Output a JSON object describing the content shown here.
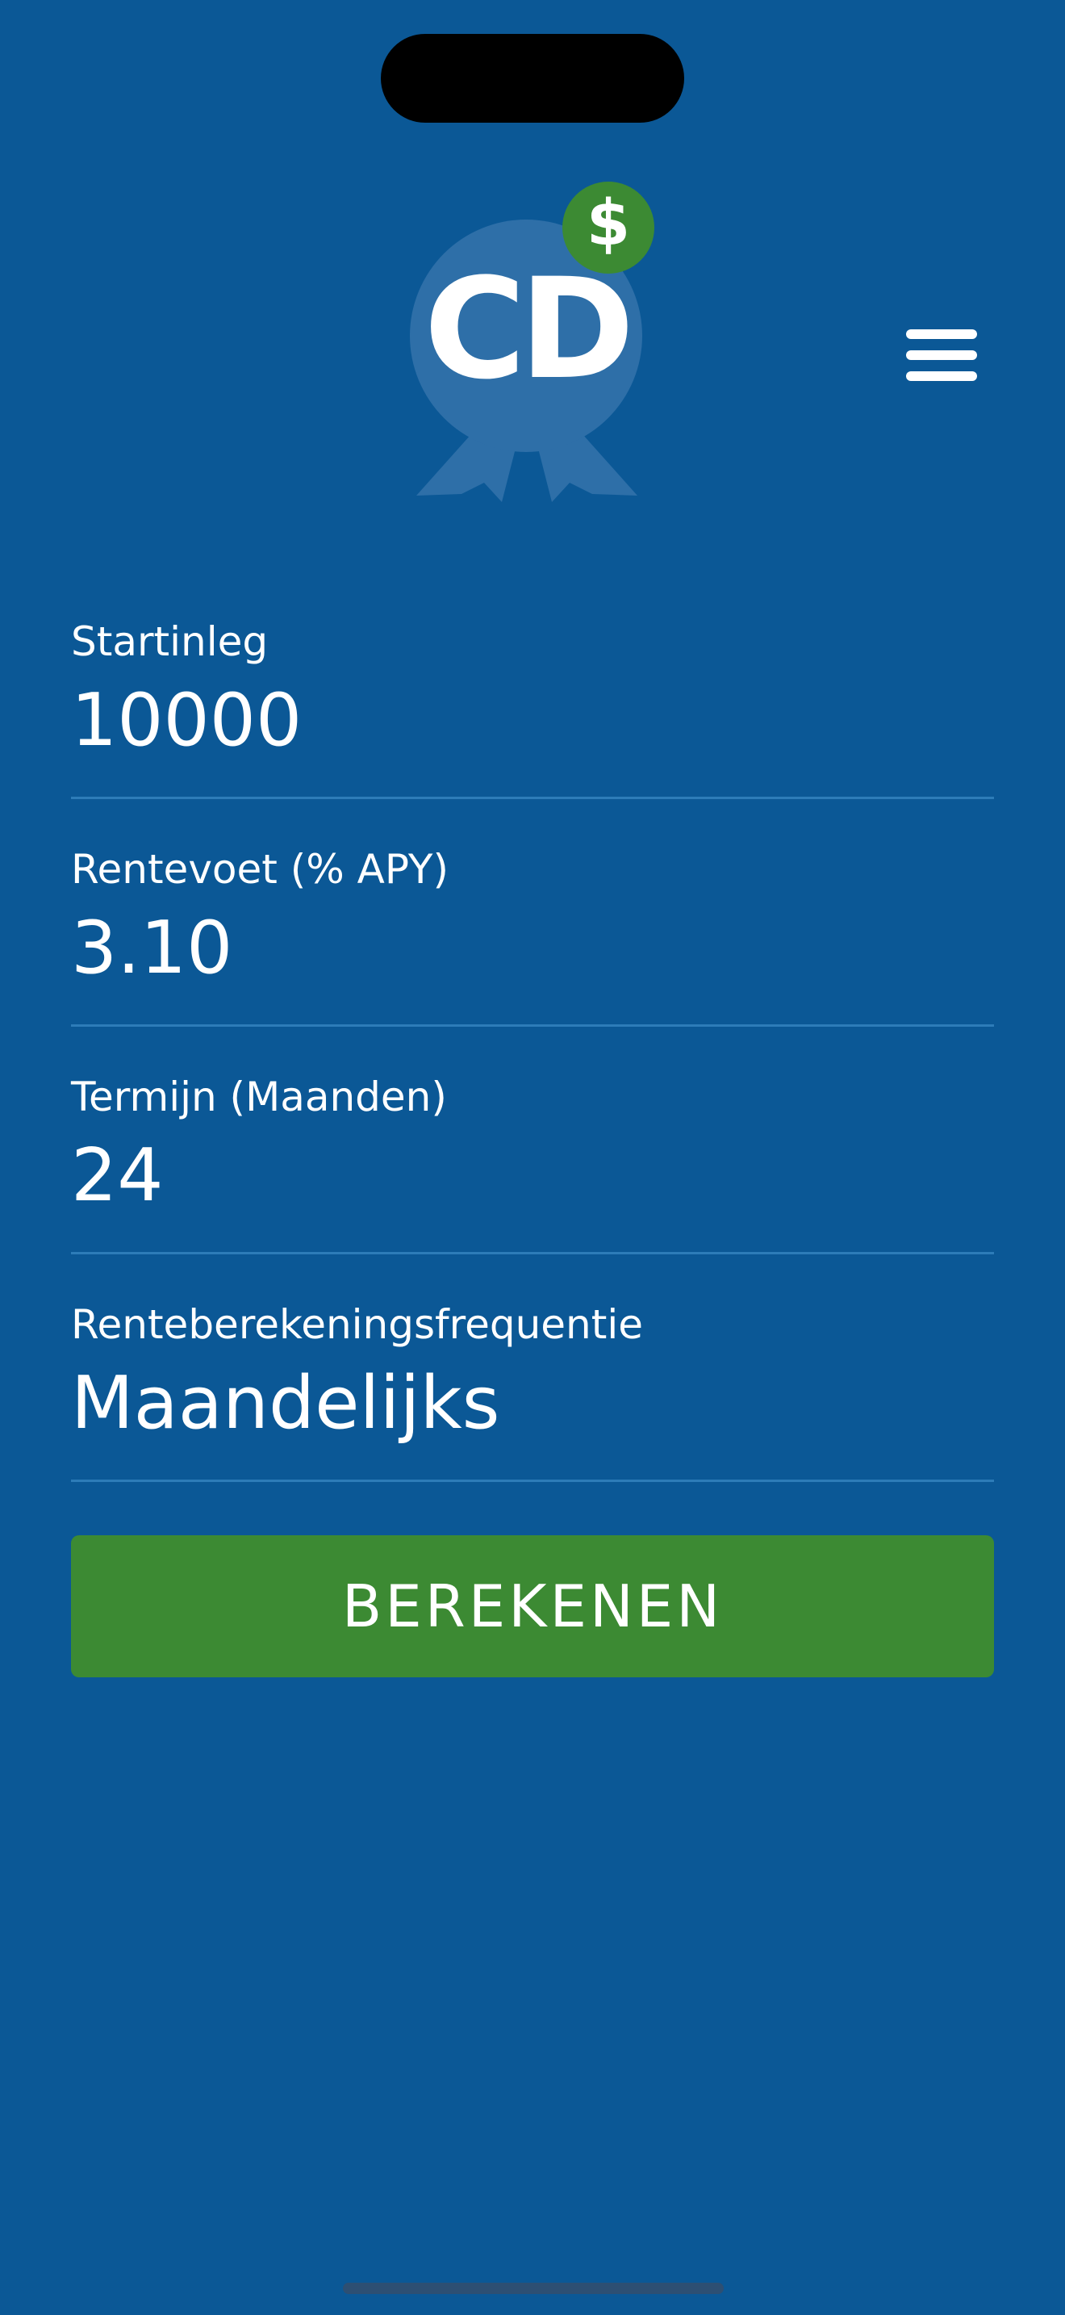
{
  "logo": {
    "text": "CD",
    "badge_symbol": "$",
    "icon": "cd-award-ribbon-icon"
  },
  "header": {
    "menu_icon": "hamburger-menu-icon"
  },
  "form": {
    "fields": [
      {
        "label": "Startinleg",
        "value": "10000"
      },
      {
        "label": "Rentevoet (% APY)",
        "value": "3.10"
      },
      {
        "label": "Termijn (Maanden)",
        "value": "24"
      },
      {
        "label": "Renteberekeningsfrequentie",
        "value": "Maandelijks"
      }
    ],
    "submit_label": "BEREKENEN"
  },
  "colors": {
    "background": "#0b5896",
    "button": "#3c8a33",
    "badge": "#3c8a33",
    "ribbon": "#2e6fa8",
    "underline": "#2d7cb8"
  }
}
